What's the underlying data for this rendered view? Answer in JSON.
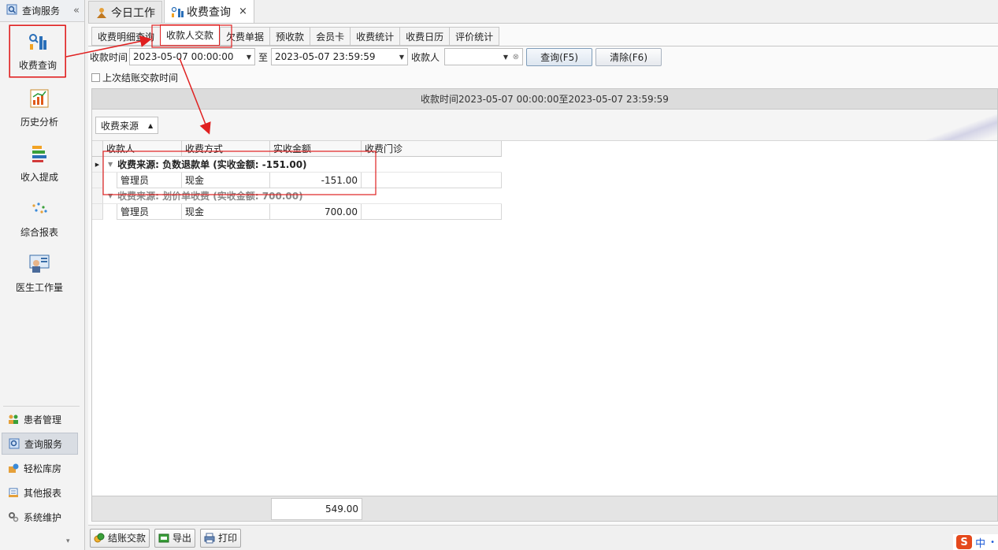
{
  "sidebar": {
    "header_title": "查询服务",
    "collapse_glyph": "«",
    "big_items": [
      {
        "label": "收费查询",
        "icon": "bar-chart-icon"
      },
      {
        "label": "历史分析",
        "icon": "analysis-chart-icon"
      },
      {
        "label": "收入提成",
        "icon": "stacked-bars-icon"
      },
      {
        "label": "综合报表",
        "icon": "dots-icon"
      },
      {
        "label": "医生工作量",
        "icon": "doctor-board-icon"
      }
    ],
    "modules": [
      {
        "label": "患者管理",
        "icon": "patients-icon"
      },
      {
        "label": "查询服务",
        "icon": "query-icon"
      },
      {
        "label": "轻松库房",
        "icon": "warehouse-icon"
      },
      {
        "label": "其他报表",
        "icon": "report-icon"
      },
      {
        "label": "系统维护",
        "icon": "settings-icon"
      }
    ],
    "more_glyph": "▾"
  },
  "doc_tabs": [
    {
      "label": "今日工作"
    },
    {
      "label": "收费查询",
      "close": "×"
    }
  ],
  "sub_tabs": [
    "收费明细查询",
    "收款人交款",
    "欠费单据",
    "预收款",
    "会员卡",
    "收费统计",
    "收费日历",
    "评价统计"
  ],
  "filters": {
    "time_label": "收款时间",
    "start_time": "2023-05-07 00:00:00",
    "to_label": "至",
    "end_time": "2023-05-07 23:59:59",
    "payee_label": "收款人",
    "payee_value": "",
    "query_button": "查询(F5)",
    "clear_button": "清除(F6)"
  },
  "checkbox": {
    "label": "上次结账交款时间",
    "checked": false
  },
  "grid": {
    "title": "收款时间2023-05-07 00:00:00至2023-05-07 23:59:59",
    "group_chip": "收费来源",
    "columns": [
      "收款人",
      "收费方式",
      "实收金额",
      "收费门诊"
    ],
    "groups": [
      {
        "header": "收费来源: 负数退款单 (实收金额: -151.00)",
        "rows": [
          [
            "管理员",
            "现金",
            "-151.00",
            ""
          ]
        ]
      },
      {
        "header": "收费来源: 划价单收费 (实收金额: 700.00)",
        "rows": [
          [
            "管理员",
            "现金",
            "700.00",
            ""
          ]
        ]
      }
    ],
    "total": "549.00"
  },
  "toolbar": {
    "settle_button": "结账交款",
    "export_button": "导出",
    "print_button": "打印"
  },
  "ime": {
    "logo": "S",
    "mode": "中",
    "dot": "•"
  },
  "colors": {
    "annotation": "#e02020",
    "accent": "#1e5bd8"
  }
}
